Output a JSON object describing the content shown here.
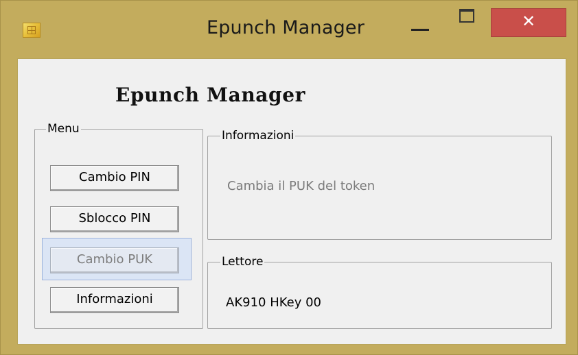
{
  "window": {
    "title": "Epunch Manager",
    "close_glyph": "✕",
    "icon": "smartcard-chip-icon"
  },
  "app": {
    "heading": "Epunch Manager"
  },
  "menu": {
    "legend": "Menu",
    "items": [
      {
        "label": "Cambio PIN"
      },
      {
        "label": "Sblocco PIN"
      },
      {
        "label": "Cambio PUK",
        "state": "selected"
      },
      {
        "label": "Informazioni"
      }
    ]
  },
  "info_panel": {
    "legend": "Informazioni",
    "text": "Cambia il PUK del token"
  },
  "reader_panel": {
    "legend": "Lettore",
    "value": "AK910 HKey 00"
  },
  "colors": {
    "frame": "#c3ac5d",
    "close_button": "#c94f4a",
    "client_bg": "#f0f0f0",
    "selection": "#dbe5f5"
  }
}
